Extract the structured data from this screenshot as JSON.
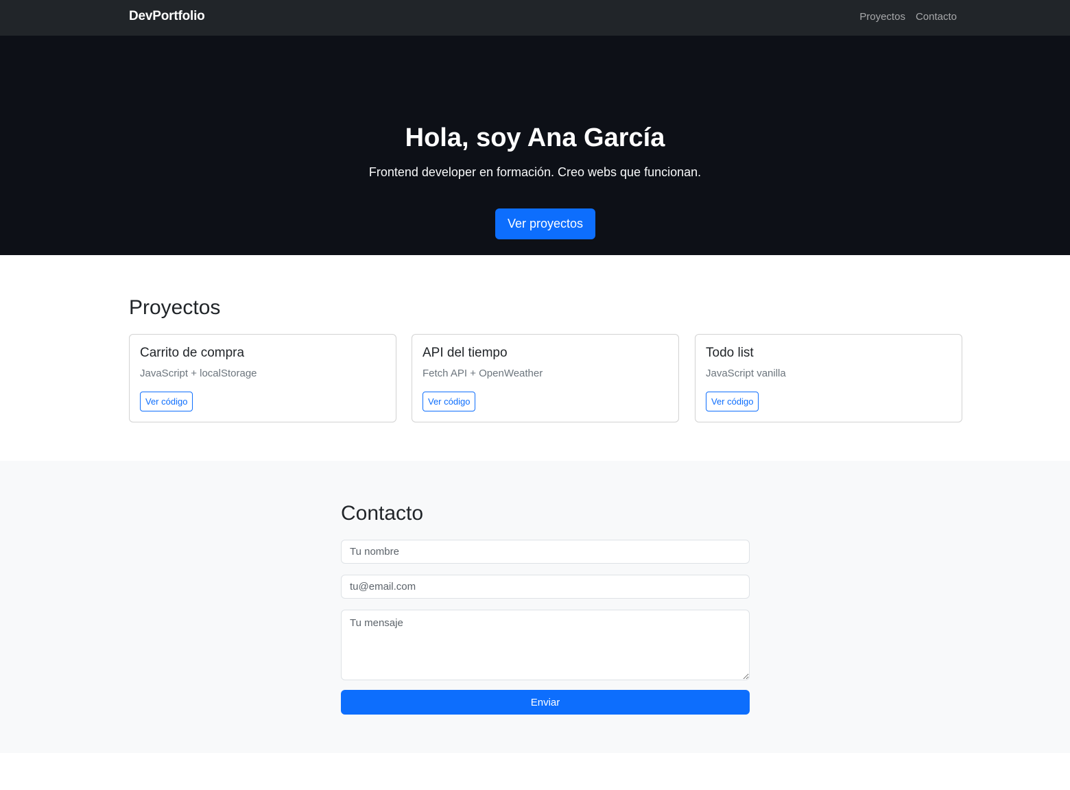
{
  "navbar": {
    "brand": "DevPortfolio",
    "links": [
      "Proyectos",
      "Contacto"
    ]
  },
  "hero": {
    "title": "Hola, soy Ana García",
    "subtitle": "Frontend developer en formación. Creo webs que funcionan.",
    "button_label": "Ver proyectos"
  },
  "projects": {
    "title": "Proyectos",
    "cards": [
      {
        "title": "Carrito de compra",
        "text": "JavaScript + localStorage",
        "button": "Ver código"
      },
      {
        "title": "API del tiempo",
        "text": "Fetch API + OpenWeather",
        "button": "Ver código"
      },
      {
        "title": "Todo list",
        "text": "JavaScript vanilla",
        "button": "Ver código"
      }
    ]
  },
  "contact": {
    "title": "Contacto",
    "name_placeholder": "Tu nombre",
    "email_placeholder": "tu@email.com",
    "message_placeholder": "Tu mensaje",
    "submit_label": "Enviar"
  },
  "colors": {
    "navbar_bg": "#212529",
    "hero_bg": "#0d1017",
    "primary": "#0d6efd",
    "contact_bg": "#f8f9fa"
  }
}
